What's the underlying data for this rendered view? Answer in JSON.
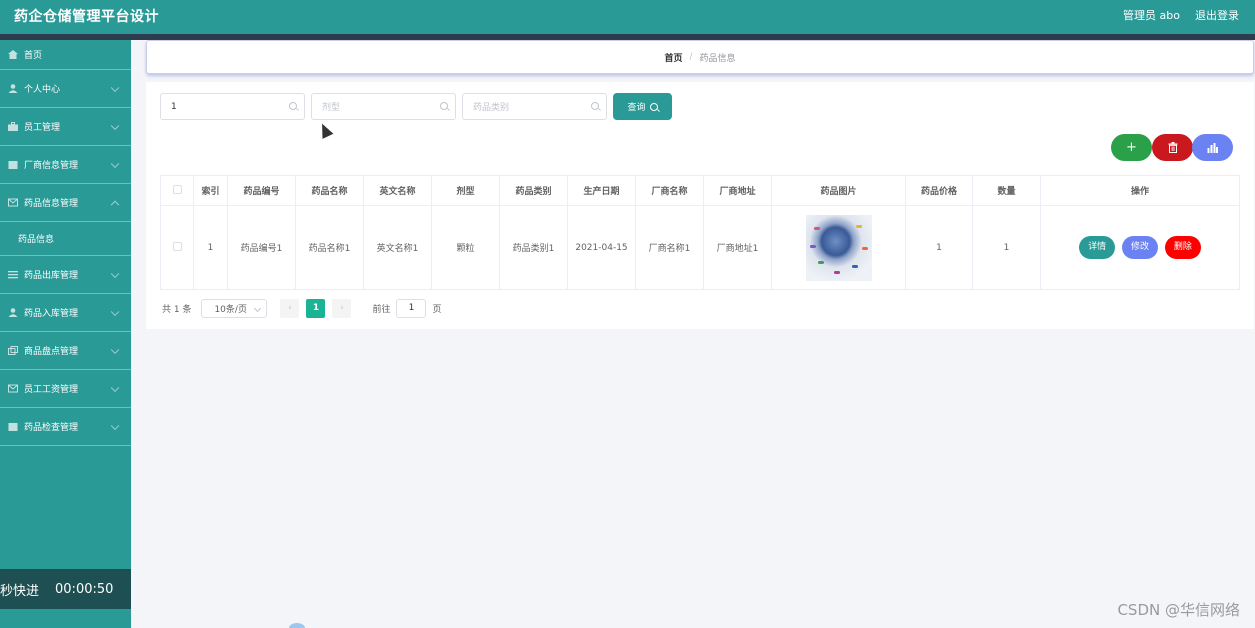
{
  "header": {
    "title": "药企仓储管理平台设计",
    "admin_label": "管理员 abo",
    "logout_label": "退出登录"
  },
  "sidebar": {
    "items": [
      {
        "label": "首页",
        "icon": "home-icon"
      },
      {
        "label": "个人中心",
        "icon": "user-icon"
      },
      {
        "label": "员工管理",
        "icon": "briefcase-icon"
      },
      {
        "label": "厂商信息管理",
        "icon": "calendar-icon"
      },
      {
        "label": "药品信息管理",
        "icon": "mail-icon"
      },
      {
        "label": "药品信息",
        "icon": ""
      },
      {
        "label": "药品出库管理",
        "icon": "list-icon"
      },
      {
        "label": "药品入库管理",
        "icon": "user-icon"
      },
      {
        "label": "商品盘点管理",
        "icon": "copy-icon"
      },
      {
        "label": "员工工资管理",
        "icon": "mail-icon"
      },
      {
        "label": "药品检查管理",
        "icon": "calendar-icon"
      }
    ]
  },
  "timer": {
    "label": "秒快进",
    "time": "00:00:50"
  },
  "breadcrumb": {
    "home": "首页",
    "separator": "/",
    "current": "药品信息"
  },
  "search": {
    "name_value": "1",
    "type_placeholder": "剂型",
    "category_placeholder": "药品类别",
    "query_label": "查询"
  },
  "actions": {
    "add_symbol": "+",
    "delete_icon": "trash-icon",
    "chart_icon": "bar-chart-icon"
  },
  "table": {
    "headers": [
      "",
      "索引",
      "药品编号",
      "药品名称",
      "英文名称",
      "剂型",
      "药品类别",
      "生产日期",
      "厂商名称",
      "厂商地址",
      "药品图片",
      "药品价格",
      "数量",
      "操作"
    ],
    "rows": [
      {
        "index": "1",
        "code": "药品编号1",
        "name": "药品名称1",
        "english_name": "英文名称1",
        "form": "颗粒",
        "category": "药品类别1",
        "date": "2021-04-15",
        "maker": "厂商名称1",
        "address": "厂商地址1",
        "price": "1",
        "quantity": "1",
        "detail_label": "详情",
        "edit_label": "修改",
        "delete_label": "删除"
      }
    ]
  },
  "pagination": {
    "total": "共 1 条",
    "page_size": "10条/页",
    "prev": "‹",
    "current_page": "1",
    "next": "›",
    "goto_label": "前往",
    "goto_value": "1",
    "page_suffix": "页"
  },
  "watermark": "CSDN @华信网络"
}
